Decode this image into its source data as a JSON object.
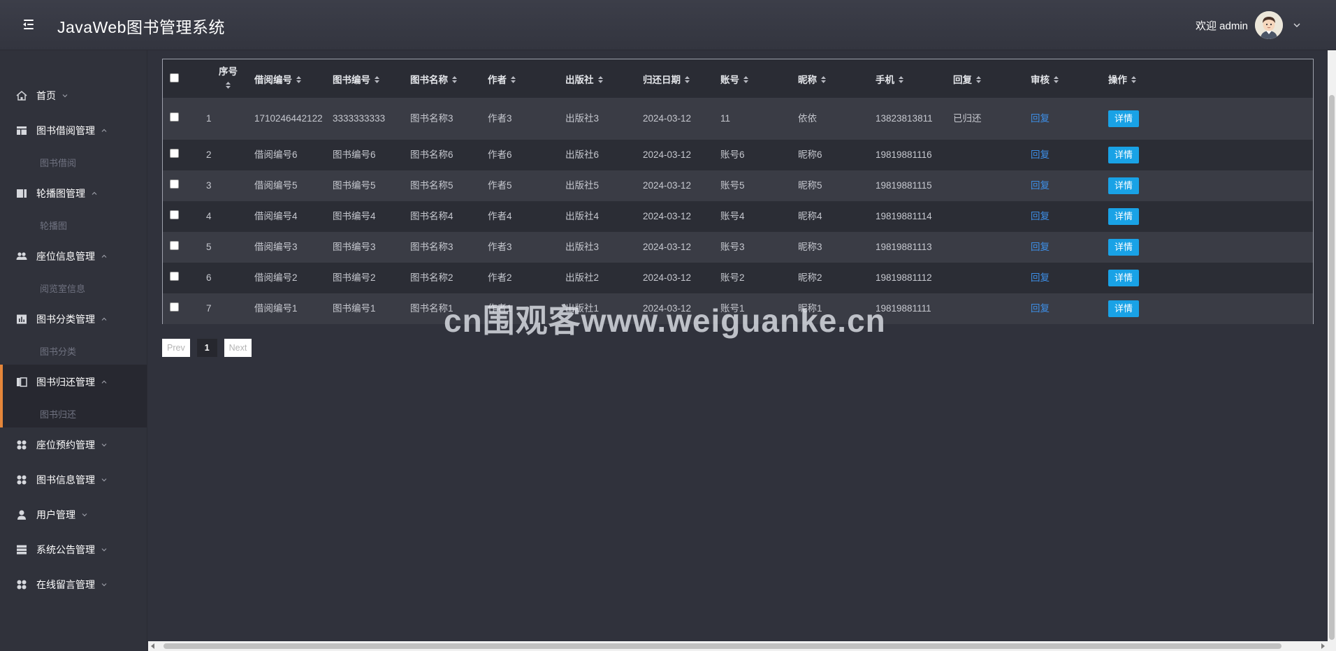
{
  "header": {
    "title": "JavaWeb图书管理系统",
    "welcome": "欢迎 admin"
  },
  "sidebar": {
    "items": [
      {
        "label": "首页",
        "icon": "home-icon",
        "expanded": false,
        "children": []
      },
      {
        "label": "图书借阅管理",
        "icon": "layout-icon",
        "expanded": true,
        "children": [
          "图书借阅"
        ]
      },
      {
        "label": "轮播图管理",
        "icon": "columns-icon",
        "expanded": true,
        "children": [
          "轮播图"
        ]
      },
      {
        "label": "座位信息管理",
        "icon": "users-icon",
        "expanded": true,
        "children": [
          "阅览室信息"
        ]
      },
      {
        "label": "图书分类管理",
        "icon": "chart-icon",
        "expanded": true,
        "children": [
          "图书分类"
        ]
      },
      {
        "label": "图书归还管理",
        "icon": "book-return-icon",
        "expanded": true,
        "active": true,
        "children": [
          "图书归还"
        ]
      },
      {
        "label": "座位预约管理",
        "icon": "grid-dots-icon",
        "expanded": false,
        "children": []
      },
      {
        "label": "图书信息管理",
        "icon": "grid-dots-icon",
        "expanded": false,
        "children": []
      },
      {
        "label": "用户管理",
        "icon": "user-icon",
        "expanded": false,
        "children": []
      },
      {
        "label": "系统公告管理",
        "icon": "server-icon",
        "expanded": false,
        "children": []
      },
      {
        "label": "在线留言管理",
        "icon": "grid-dots-icon",
        "expanded": false,
        "children": []
      }
    ]
  },
  "table": {
    "columns": [
      "序号",
      "借阅编号",
      "图书编号",
      "图书名称",
      "作者",
      "出版社",
      "归还日期",
      "账号",
      "昵称",
      "手机",
      "回复",
      "审核",
      "操作"
    ],
    "rows": [
      {
        "no": "1",
        "borrow_no": "1710246442122",
        "book_no": "3333333333",
        "book_name": "图书名称3",
        "author": "作者3",
        "publisher": "出版社3",
        "return_date": "2024-03-12",
        "account": "11",
        "nickname": "依依",
        "phone": "13823813811",
        "reply": "已归还",
        "review": "回复",
        "action": "详情"
      },
      {
        "no": "2",
        "borrow_no": "借阅编号6",
        "book_no": "图书编号6",
        "book_name": "图书名称6",
        "author": "作者6",
        "publisher": "出版社6",
        "return_date": "2024-03-12",
        "account": "账号6",
        "nickname": "昵称6",
        "phone": "19819881116",
        "reply": "",
        "review": "回复",
        "action": "详情"
      },
      {
        "no": "3",
        "borrow_no": "借阅编号5",
        "book_no": "图书编号5",
        "book_name": "图书名称5",
        "author": "作者5",
        "publisher": "出版社5",
        "return_date": "2024-03-12",
        "account": "账号5",
        "nickname": "昵称5",
        "phone": "19819881115",
        "reply": "",
        "review": "回复",
        "action": "详情"
      },
      {
        "no": "4",
        "borrow_no": "借阅编号4",
        "book_no": "图书编号4",
        "book_name": "图书名称4",
        "author": "作者4",
        "publisher": "出版社4",
        "return_date": "2024-03-12",
        "account": "账号4",
        "nickname": "昵称4",
        "phone": "19819881114",
        "reply": "",
        "review": "回复",
        "action": "详情"
      },
      {
        "no": "5",
        "borrow_no": "借阅编号3",
        "book_no": "图书编号3",
        "book_name": "图书名称3",
        "author": "作者3",
        "publisher": "出版社3",
        "return_date": "2024-03-12",
        "account": "账号3",
        "nickname": "昵称3",
        "phone": "19819881113",
        "reply": "",
        "review": "回复",
        "action": "详情"
      },
      {
        "no": "6",
        "borrow_no": "借阅编号2",
        "book_no": "图书编号2",
        "book_name": "图书名称2",
        "author": "作者2",
        "publisher": "出版社2",
        "return_date": "2024-03-12",
        "account": "账号2",
        "nickname": "昵称2",
        "phone": "19819881112",
        "reply": "",
        "review": "回复",
        "action": "详情"
      },
      {
        "no": "7",
        "borrow_no": "借阅编号1",
        "book_no": "图书编号1",
        "book_name": "图书名称1",
        "author": "作者1",
        "publisher": "出版社1",
        "return_date": "2024-03-12",
        "account": "账号1",
        "nickname": "昵称1",
        "phone": "19819881111",
        "reply": "",
        "review": "回复",
        "action": "详情"
      }
    ]
  },
  "pagination": {
    "prev": "Prev",
    "current": "1",
    "next": "Next"
  },
  "watermark": "cn围观客www.weiguanke.cn",
  "colors": {
    "accent": "#e5863a",
    "button": "#19a2e6",
    "link": "#3d8fe8"
  }
}
